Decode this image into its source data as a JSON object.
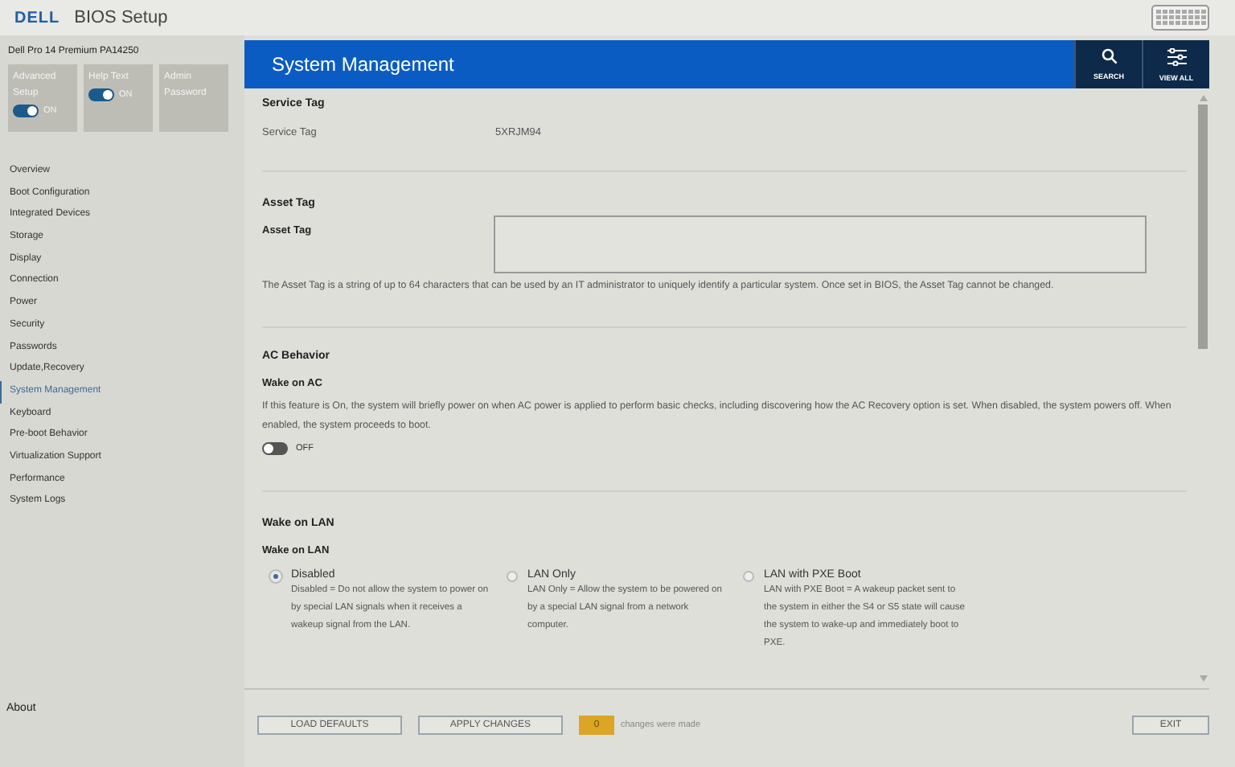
{
  "app": {
    "logo": "DELL",
    "title": "BIOS Setup"
  },
  "device": "Dell Pro 14 Premium PA14250",
  "tiles": [
    {
      "label": "Advanced Setup",
      "kind": "toggle",
      "on": true,
      "state_label": "ON"
    },
    {
      "label": "Help Text",
      "kind": "toggle",
      "on": true,
      "state_label": "ON"
    },
    {
      "label": "Admin Password",
      "kind": "plain"
    }
  ],
  "nav": [
    {
      "label": "Overview",
      "selected": false
    },
    {
      "label": "Boot Configuration",
      "selected": false
    },
    {
      "label": "Integrated Devices",
      "selected": false
    },
    {
      "label": "Storage",
      "selected": false
    },
    {
      "label": "Display",
      "selected": false
    },
    {
      "label": "Connection",
      "selected": false
    },
    {
      "label": "Power",
      "selected": false
    },
    {
      "label": "Security",
      "selected": false
    },
    {
      "label": "Passwords",
      "selected": false
    },
    {
      "label": "Update,Recovery",
      "selected": false
    },
    {
      "label": "System Management",
      "selected": true
    },
    {
      "label": "Keyboard",
      "selected": false
    },
    {
      "label": "Pre-boot Behavior",
      "selected": false
    },
    {
      "label": "Virtualization Support",
      "selected": false
    },
    {
      "label": "Performance",
      "selected": false
    },
    {
      "label": "System Logs",
      "selected": false
    }
  ],
  "about": "About",
  "page": {
    "title": "System Management",
    "actions": [
      {
        "label": "SEARCH",
        "kind": "search"
      },
      {
        "label": "VIEW ALL",
        "kind": "viewall"
      }
    ]
  },
  "sections": [
    {
      "kind": "readonly",
      "heading": "Service Tag",
      "label": "Service Tag",
      "value": "5XRJM94"
    },
    {
      "kind": "text",
      "heading": "Asset Tag",
      "label": "Asset Tag",
      "help": "The Asset Tag is a string of up to 64 characters that can be used by an IT administrator to uniquely identify a particular system. Once set in BIOS, the Asset Tag cannot be changed."
    },
    {
      "kind": "toggle",
      "heading": "AC Behavior",
      "label": "Wake on AC",
      "help": "If this feature is On, the system will briefly power on when AC power is applied to perform basic checks, including discovering how the AC Recovery option is set. When disabled, the system powers off. When enabled, the system proceeds to boot.",
      "on": false,
      "state_label": "OFF"
    },
    {
      "kind": "radio",
      "heading": "Wake on LAN",
      "label": "Wake on LAN",
      "options": [
        {
          "label": "Disabled",
          "desc": "Disabled = Do not allow the system to power on by special LAN signals when it receives a wakeup signal from the LAN.",
          "selected": true
        },
        {
          "label": "LAN Only",
          "desc": "LAN Only = Allow the system to be powered on by a special LAN signal from a network computer.",
          "selected": false
        },
        {
          "label": "LAN with PXE Boot",
          "desc": "LAN with PXE Boot = A wakeup packet sent to the system in either the S4 or S5 state will cause the system to wake-up and immediately boot to PXE.",
          "selected": false
        }
      ]
    }
  ],
  "footer": {
    "buttons": [
      "LOAD DEFAULTS",
      "APPLY CHANGES"
    ],
    "count": "0",
    "count_text": "changes were made",
    "exit": "EXIT"
  }
}
